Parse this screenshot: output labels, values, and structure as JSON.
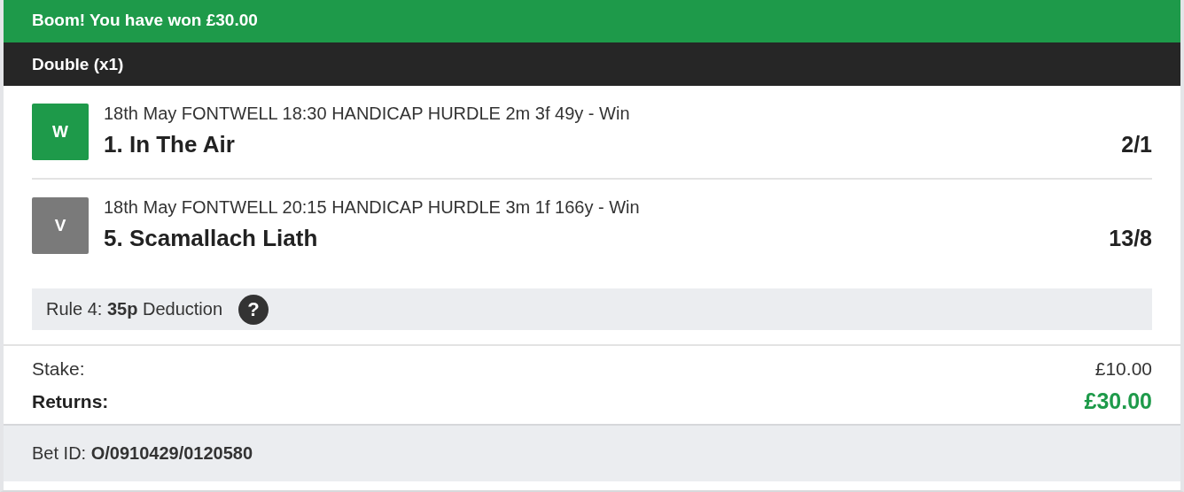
{
  "banner": {
    "title": "Boom! You have won £30.00"
  },
  "bet_type": {
    "title": "Double (x1)"
  },
  "legs": [
    {
      "badge": "W",
      "color": "#1e9a4a",
      "event": "18th May FONTWELL 18:30 HANDICAP HURDLE 2m 3f 49y - Win",
      "selection": "1. In The Air",
      "odds": "2/1"
    },
    {
      "badge": "V",
      "color": "#7a7a7a",
      "event": "18th May FONTWELL 20:15 HANDICAP HURDLE 3m 1f 166y - Win",
      "selection": "5. Scamallach Liath",
      "odds": "13/8"
    }
  ],
  "rule4": {
    "text": "Rule 4: **35p** Deduction",
    "help": "?"
  },
  "summary": {
    "stake_label": "Stake:",
    "stake": "£10.00",
    "returns_label": "Returns:",
    "returns": "£30.00"
  },
  "footer": {
    "bet_id": "Bet ID: **O/0910429/0120580**"
  }
}
